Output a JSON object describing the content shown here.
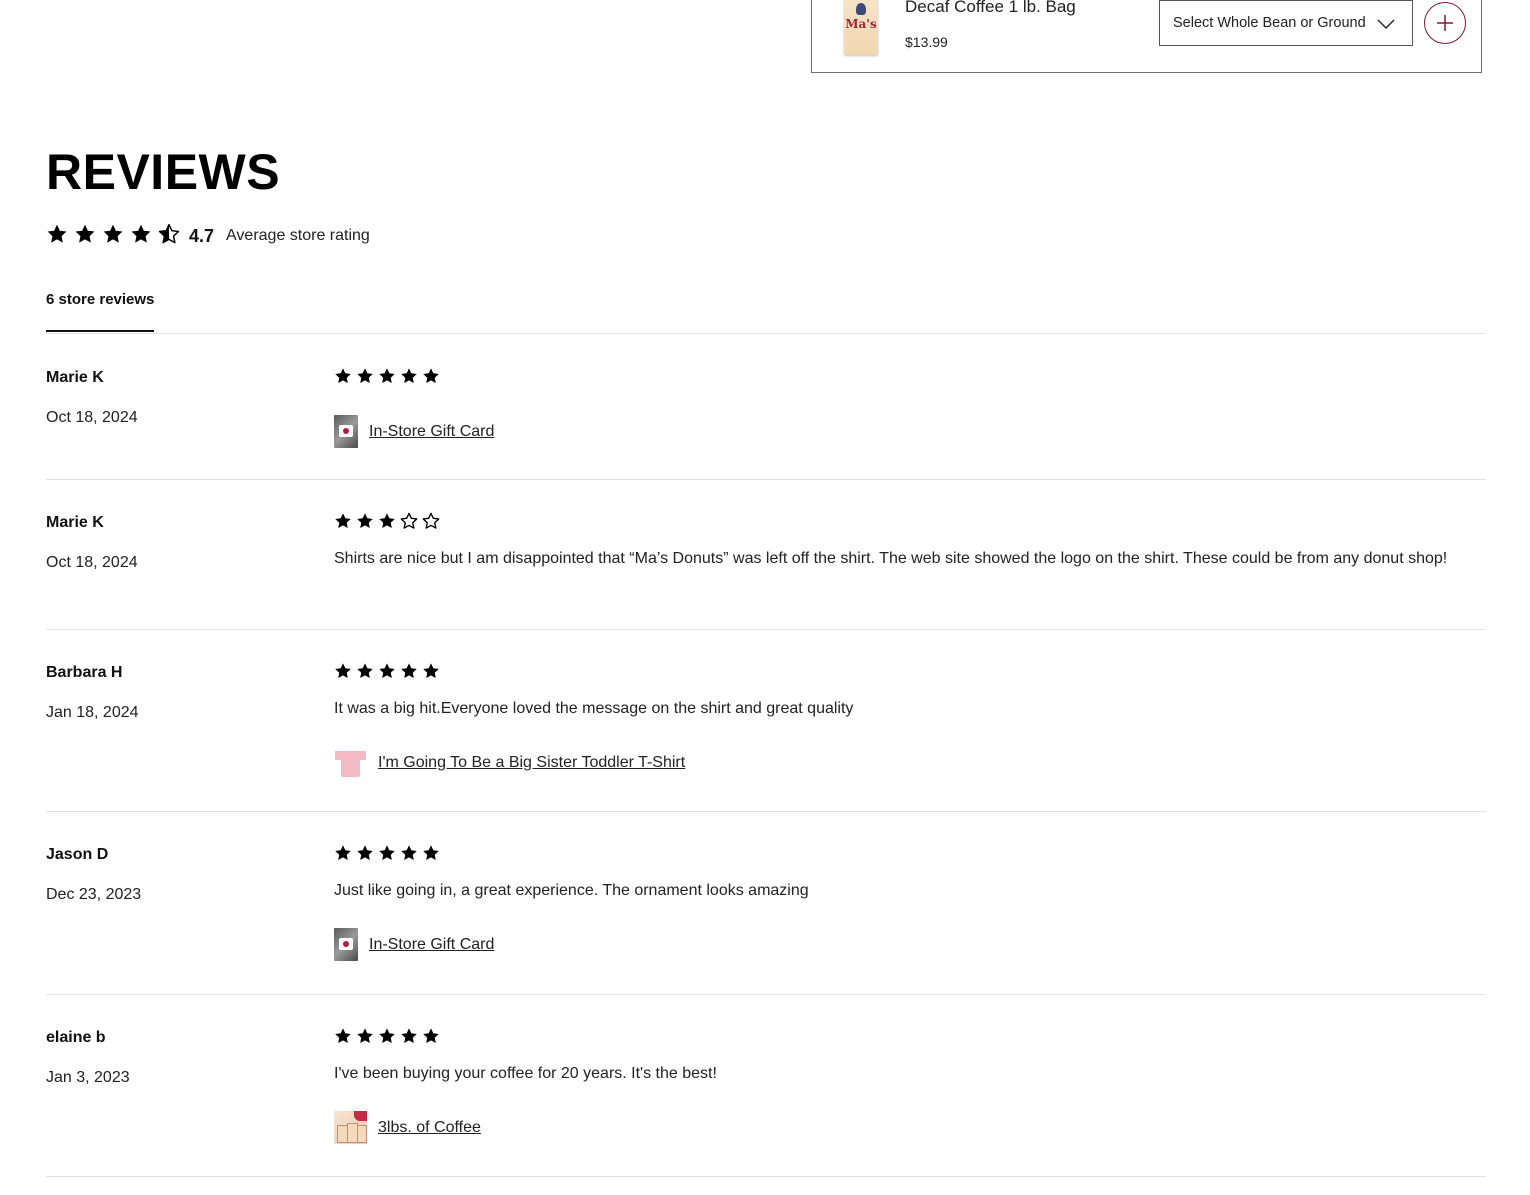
{
  "product_card": {
    "name": "Decaf Coffee 1 lb. Bag",
    "price": "$13.99",
    "thumb_brand": "Ma's",
    "variant_select": "Select Whole Bean or Ground",
    "chevron_icon": "chevron-down-icon",
    "add_icon": "plus-icon"
  },
  "reviews": {
    "title": "REVIEWS",
    "average_rating": "4.7",
    "average_value": 4.7,
    "average_label": "Average store rating",
    "tab_label": "6 store reviews",
    "items": [
      {
        "author": "Marie K",
        "date": "Oct 18, 2024",
        "rating": 5,
        "text": "",
        "product": "In-Store Gift Card",
        "product_thumb": "gift-card"
      },
      {
        "author": "Marie K",
        "date": "Oct 18, 2024",
        "rating": 3,
        "text": "Shirts are nice but I am disappointed that “Ma’s Donuts” was left off the shirt. The web site showed the logo on the shirt. These could be from any donut shop!",
        "product": "",
        "product_thumb": ""
      },
      {
        "author": "Barbara H",
        "date": "Jan 18, 2024",
        "rating": 5,
        "text": "It was a big hit.Everyone loved the message on the shirt and great quality",
        "product": "I'm Going To Be a Big Sister Toddler T-Shirt",
        "product_thumb": "shirt"
      },
      {
        "author": "Jason D",
        "date": "Dec 23, 2023",
        "rating": 5,
        "text": "Just like going in, a great experience. The ornament looks amazing",
        "product": "In-Store Gift Card",
        "product_thumb": "gift-card"
      },
      {
        "author": "elaine b",
        "date": "Jan 3, 2023",
        "rating": 5,
        "text": "I've been buying your coffee for 20 years. It's the best!",
        "product": "3lbs. of Coffee",
        "product_thumb": "coffee"
      }
    ]
  },
  "colors": {
    "accent": "#7a1b34",
    "divider": "#e2e2e2",
    "star": "#000000"
  }
}
